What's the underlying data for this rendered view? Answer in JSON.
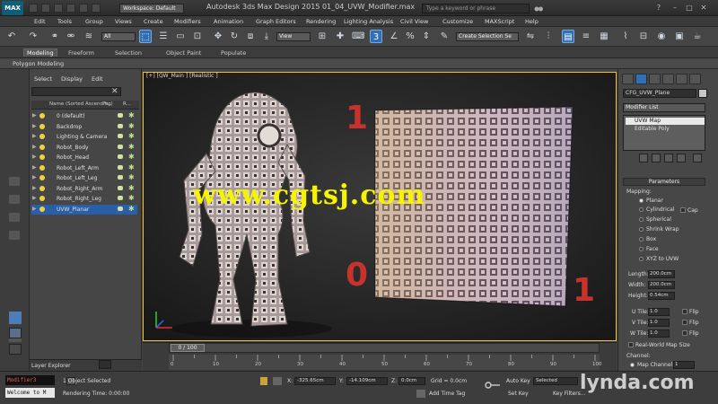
{
  "app": {
    "logo": "MAX",
    "title": "Autodesk 3ds Max Design 2015     01_04_UVW_Modifier.max",
    "workspace": "Workspace: Default",
    "search_placeholder": "Type a keyword or phrase"
  },
  "menu": [
    "Edit",
    "Tools",
    "Group",
    "Views",
    "Create",
    "Modifiers",
    "Animation",
    "Graph Editors",
    "Rendering",
    "Lighting Analysis",
    "Civil View",
    "Customize",
    "MAXScript",
    "Help"
  ],
  "toolbar": {
    "selection_filter": "All",
    "ref_coord": "View",
    "named_selection": "Create Selection Se"
  },
  "ribbon": {
    "tabs": [
      "Modeling",
      "Freeform",
      "Selection",
      "Object Paint",
      "Populate"
    ],
    "active_tab": "Modeling",
    "sub": "Polygon Modeling"
  },
  "scene_explorer": {
    "tabs": [
      "Select",
      "Display",
      "Edit"
    ],
    "columns": [
      "Name (Sorted Ascending)",
      "Fr...",
      "R..."
    ],
    "layers": [
      {
        "name": "0 (default)",
        "selected": false
      },
      {
        "name": "Backdrop",
        "selected": false
      },
      {
        "name": "Lighting & Camera",
        "selected": false
      },
      {
        "name": "Robot_Body",
        "selected": false
      },
      {
        "name": "Robot_Head",
        "selected": false
      },
      {
        "name": "Robot_Left_Arm",
        "selected": false
      },
      {
        "name": "Robot_Left_Leg",
        "selected": false
      },
      {
        "name": "Robot_Right_Arm",
        "selected": false
      },
      {
        "name": "Robot_Right_Leg",
        "selected": false
      },
      {
        "name": "UVW_Planar",
        "selected": true
      }
    ],
    "footer": "Layer Explorer"
  },
  "viewport": {
    "label": "[+] [QW_Main ] [Realistic ]",
    "num_top": "1",
    "num_bottom_left": "0",
    "num_bottom_right": "1",
    "watermark": "www.cgtsj.com",
    "grid_rows": [
      "ABCDEFGHIJKLM"
    ]
  },
  "command_panel": {
    "object_name": "CFG_UVW_Plane",
    "modifier_list": "Modifier List",
    "stack": [
      {
        "label": "UVW Map",
        "selected": true
      },
      {
        "label": "Editable Poly",
        "selected": false
      }
    ],
    "params_title": "Parameters",
    "mapping_label": "Mapping:",
    "mapping_options": [
      "Planar",
      "Cylindrical",
      "Spherical",
      "Shrink Wrap",
      "Box",
      "Face",
      "XYZ to UVW"
    ],
    "cap_label": "Cap",
    "length_label": "Length:",
    "length_value": "200.0cm",
    "width_label": "Width:",
    "width_value": "200.0cm",
    "height_label": "Height:",
    "height_value": "0.54cm",
    "utile_label": "U Tile:",
    "utile_value": "1.0",
    "vtile_label": "V Tile:",
    "vtile_value": "1.0",
    "wtile_label": "W Tile:",
    "wtile_value": "1.0",
    "flip_label": "Flip",
    "realworld_label": "Real-World Map Size",
    "channel_label": "Channel:",
    "mapchannel_label": "Map Channel:",
    "mapchannel_value": "1"
  },
  "timeline": {
    "frame_display": "0 / 100",
    "ticks": [
      "0",
      "10",
      "20",
      "30",
      "40",
      "50",
      "60",
      "70",
      "80",
      "90",
      "100"
    ]
  },
  "status": {
    "maxscript_top": "Modifier3",
    "maxscript_bottom": "Welcome to M",
    "selection": "1 Object Selected",
    "prompt": "Rendering Time: 0:00:00",
    "x_label": "X:",
    "x_value": "-325.65cm",
    "y_label": "Y:",
    "y_value": "-14.109cm",
    "z_label": "Z:",
    "z_value": "0.0cm",
    "grid": "Grid = 0.0cm",
    "add_time_tag": "Add Time Tag",
    "auto_key": "Auto Key",
    "set_key": "Set Key",
    "selected_dd": "Selected",
    "key_filters": "Key Filters...",
    "lynda": "lynda.com"
  }
}
